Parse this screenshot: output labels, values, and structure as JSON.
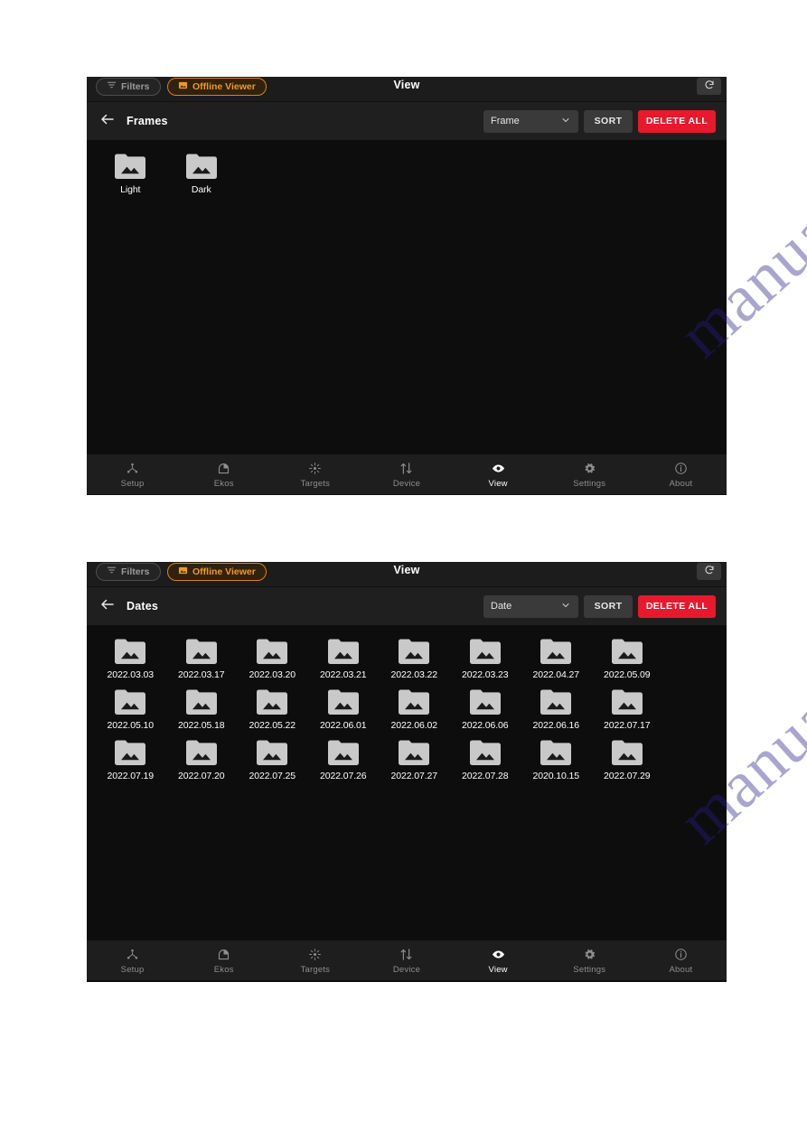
{
  "watermark": {
    "text": "manualshive.com"
  },
  "screens": [
    {
      "id": "frames-screen",
      "chips": {
        "filters_label": "Filters",
        "filters_icon": "funnel-icon",
        "offline_label": "Offline Viewer",
        "offline_icon": "image-icon",
        "title": "View",
        "refresh_icon": "refresh-icon"
      },
      "action_bar": {
        "back_icon": "back-arrow-icon",
        "title": "Frames",
        "select_value": "Frame",
        "select_caret": "chevron-down-icon",
        "sort_label": "SORT",
        "delete_label": "DELETE ALL"
      },
      "folders": [
        {
          "label": "Light",
          "icon": "folder-image-icon"
        },
        {
          "label": "Dark",
          "icon": "folder-image-icon"
        }
      ],
      "nav": [
        {
          "label": "Setup",
          "icon": "setup-icon",
          "active": false
        },
        {
          "label": "Ekos",
          "icon": "ekos-dome-icon",
          "active": false
        },
        {
          "label": "Targets",
          "icon": "targets-star-icon",
          "active": false
        },
        {
          "label": "Device",
          "icon": "device-transfer-icon",
          "active": false
        },
        {
          "label": "View",
          "icon": "eye-icon",
          "active": true
        },
        {
          "label": "Settings",
          "icon": "gear-icon",
          "active": false
        },
        {
          "label": "About",
          "icon": "info-icon",
          "active": false
        }
      ]
    },
    {
      "id": "dates-screen",
      "chips": {
        "filters_label": "Filters",
        "filters_icon": "funnel-icon",
        "offline_label": "Offline Viewer",
        "offline_icon": "image-icon",
        "title": "View",
        "refresh_icon": "refresh-icon"
      },
      "action_bar": {
        "back_icon": "back-arrow-icon",
        "title": "Dates",
        "select_value": "Date",
        "select_caret": "chevron-down-icon",
        "sort_label": "SORT",
        "delete_label": "DELETE ALL"
      },
      "folders": [
        {
          "label": "2022.03.03",
          "icon": "folder-image-icon"
        },
        {
          "label": "2022.03.17",
          "icon": "folder-image-icon"
        },
        {
          "label": "2022.03.20",
          "icon": "folder-image-icon"
        },
        {
          "label": "2022.03.21",
          "icon": "folder-image-icon"
        },
        {
          "label": "2022.03.22",
          "icon": "folder-image-icon"
        },
        {
          "label": "2022.03.23",
          "icon": "folder-image-icon"
        },
        {
          "label": "2022.04.27",
          "icon": "folder-image-icon"
        },
        {
          "label": "2022.05.09",
          "icon": "folder-image-icon"
        },
        {
          "label": "2022.05.10",
          "icon": "folder-image-icon"
        },
        {
          "label": "2022.05.18",
          "icon": "folder-image-icon"
        },
        {
          "label": "2022.05.22",
          "icon": "folder-image-icon"
        },
        {
          "label": "2022.06.01",
          "icon": "folder-image-icon"
        },
        {
          "label": "2022.06.02",
          "icon": "folder-image-icon"
        },
        {
          "label": "2022.06.06",
          "icon": "folder-image-icon"
        },
        {
          "label": "2022.06.16",
          "icon": "folder-image-icon"
        },
        {
          "label": "2022.07.17",
          "icon": "folder-image-icon"
        },
        {
          "label": "2022.07.19",
          "icon": "folder-image-icon"
        },
        {
          "label": "2022.07.20",
          "icon": "folder-image-icon"
        },
        {
          "label": "2022.07.25",
          "icon": "folder-image-icon"
        },
        {
          "label": "2022.07.26",
          "icon": "folder-image-icon"
        },
        {
          "label": "2022.07.27",
          "icon": "folder-image-icon"
        },
        {
          "label": "2022.07.28",
          "icon": "folder-image-icon"
        },
        {
          "label": "2020.10.15",
          "icon": "folder-image-icon"
        },
        {
          "label": "2022.07.29",
          "icon": "folder-image-icon"
        }
      ],
      "nav": [
        {
          "label": "Setup",
          "icon": "setup-icon",
          "active": false
        },
        {
          "label": "Ekos",
          "icon": "ekos-dome-icon",
          "active": false
        },
        {
          "label": "Targets",
          "icon": "targets-star-icon",
          "active": false
        },
        {
          "label": "Device",
          "icon": "device-transfer-icon",
          "active": false
        },
        {
          "label": "View",
          "icon": "eye-icon",
          "active": true
        },
        {
          "label": "Settings",
          "icon": "gear-icon",
          "active": false
        },
        {
          "label": "About",
          "icon": "info-icon",
          "active": false
        }
      ]
    }
  ],
  "colors": {
    "accent_orange": "#f09a22",
    "danger_red": "#e8192c",
    "panel_bg": "#0d0d0d",
    "bar_bg": "#1f1f1f",
    "nav_bg": "#1e1e1e",
    "folder_icon": "#c9c9c9"
  }
}
